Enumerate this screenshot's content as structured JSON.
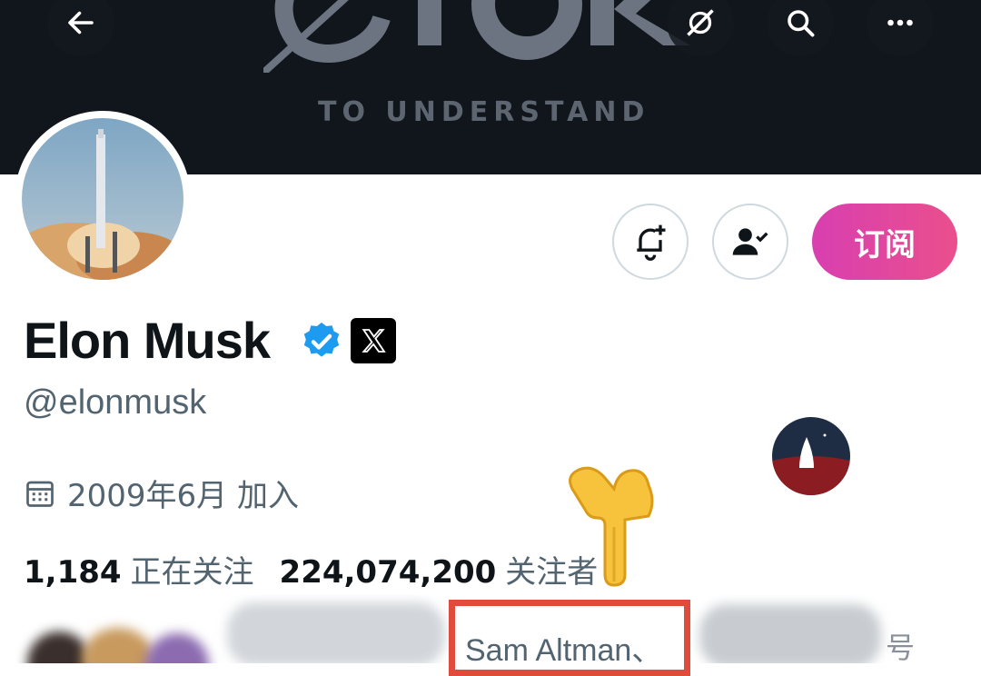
{
  "banner": {
    "tagline": "TO UNDERSTAND",
    "logo_letters": "OIOK"
  },
  "top_bar": {
    "icons": [
      "back-arrow-icon",
      "grok-icon",
      "search-icon",
      "more-icon"
    ]
  },
  "profile": {
    "display_name": "Elon Musk",
    "handle": "@elonmusk",
    "joined": "2009年6月 加入",
    "subscribe_label": "订阅",
    "stats": {
      "following_count": "1,184",
      "following_label": "正在关注",
      "followers_count": "224,074,200",
      "followers_label": "关注者"
    }
  },
  "followed_by": {
    "highlighted_name": "Sam Altman、",
    "suffix": "号"
  },
  "colors": {
    "banner_bg": "#11151c",
    "subscribe_gradient_start": "#d83fb0",
    "subscribe_gradient_end": "#ea4f8c",
    "verified_blue": "#1d9bf0",
    "highlight_red": "#e04b3c",
    "secondary_text": "#536471"
  }
}
